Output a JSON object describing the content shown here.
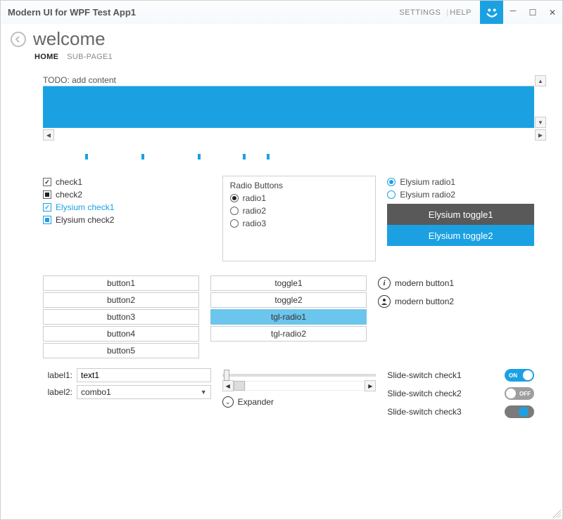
{
  "titlebar": {
    "title": "Modern UI for WPF Test App1",
    "settings": "SETTINGS",
    "help": "HELP"
  },
  "header": {
    "title": "welcome"
  },
  "subnav": {
    "home": "HOME",
    "subpage1": "SUB-PAGE1"
  },
  "todo": {
    "label": "TODO: add content"
  },
  "checks": {
    "c1": "check1",
    "c2": "check2",
    "c3": "Elysium check1",
    "c4": "Elysium check2"
  },
  "radio_group": {
    "legend": "Radio Buttons",
    "r1": "radio1",
    "r2": "radio2",
    "r3": "radio3"
  },
  "ely_radio": {
    "r1": "Elysium radio1",
    "r2": "Elysium radio2"
  },
  "ely_toggle": {
    "t1": "Elysium toggle1",
    "t2": "Elysium toggle2"
  },
  "buttons": {
    "b1": "button1",
    "b2": "button2",
    "b3": "button3",
    "b4": "button4",
    "b5": "button5"
  },
  "toggles": {
    "t1": "toggle1",
    "t2": "toggle2",
    "tr1": "tgl-radio1",
    "tr2": "tgl-radio2"
  },
  "modern_buttons": {
    "m1": "modern button1",
    "m2": "modern button2"
  },
  "form": {
    "label1": "label1:",
    "text1": "text1",
    "label2": "label2:",
    "combo1": "combo1"
  },
  "expander": {
    "label": "Expander"
  },
  "switches": {
    "s1_label": "Slide-switch check1",
    "s1_state": "ON",
    "s2_label": "Slide-switch check2",
    "s2_state": "OFF",
    "s3_label": "Slide-switch check3"
  },
  "colors": {
    "accent": "#1ba1e2",
    "toggle_dark": "#595959"
  }
}
